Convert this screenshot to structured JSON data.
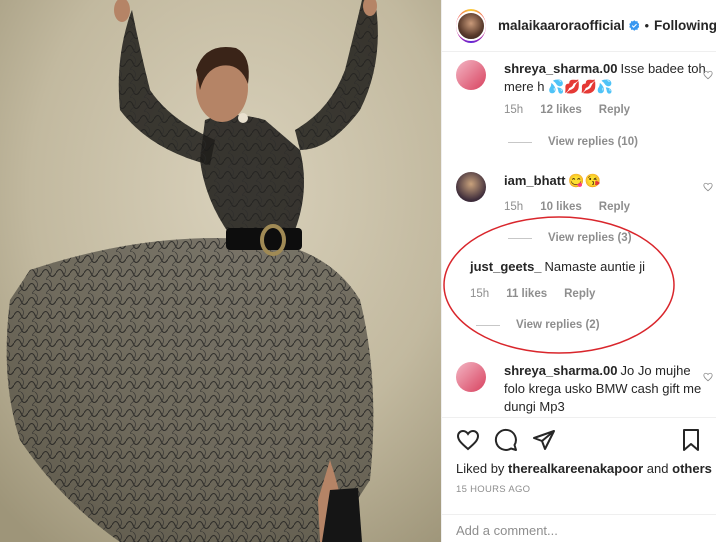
{
  "post": {
    "username": "malaikaaroraofficial",
    "separator": "•",
    "follow_status": "Following"
  },
  "comments": [
    {
      "username": "shreya_sharma.00",
      "text": "Isse badee toh mere h 💦💋💋💦",
      "time": "15h",
      "likes": "12 likes",
      "reply": "Reply",
      "view_replies": "View replies (10)"
    },
    {
      "username": "iam_bhatt",
      "text": "😋😘",
      "time": "15h",
      "likes": "10 likes",
      "reply": "Reply",
      "view_replies": "View replies (3)"
    },
    {
      "username": "just_geets_",
      "text": "Namaste auntie ji",
      "time": "15h",
      "likes": "11 likes",
      "reply": "Reply",
      "view_replies": "View replies (2)"
    },
    {
      "username": "shreya_sharma.00",
      "text": "Jo Jo mujhe folo krega usko BMW cash gift me dungi Mp3"
    }
  ],
  "actions": {
    "liked_by_prefix": "Liked by",
    "liked_by_user": "therealkareenakapoor",
    "liked_by_suffix": "and",
    "liked_by_others": "others",
    "timestamp": "15 HOURS AGO",
    "add_comment_placeholder": "Add a comment..."
  },
  "colors": {
    "highlight": "#d9262c",
    "verified": "#3897f0",
    "muted": "#8e8e8e"
  }
}
